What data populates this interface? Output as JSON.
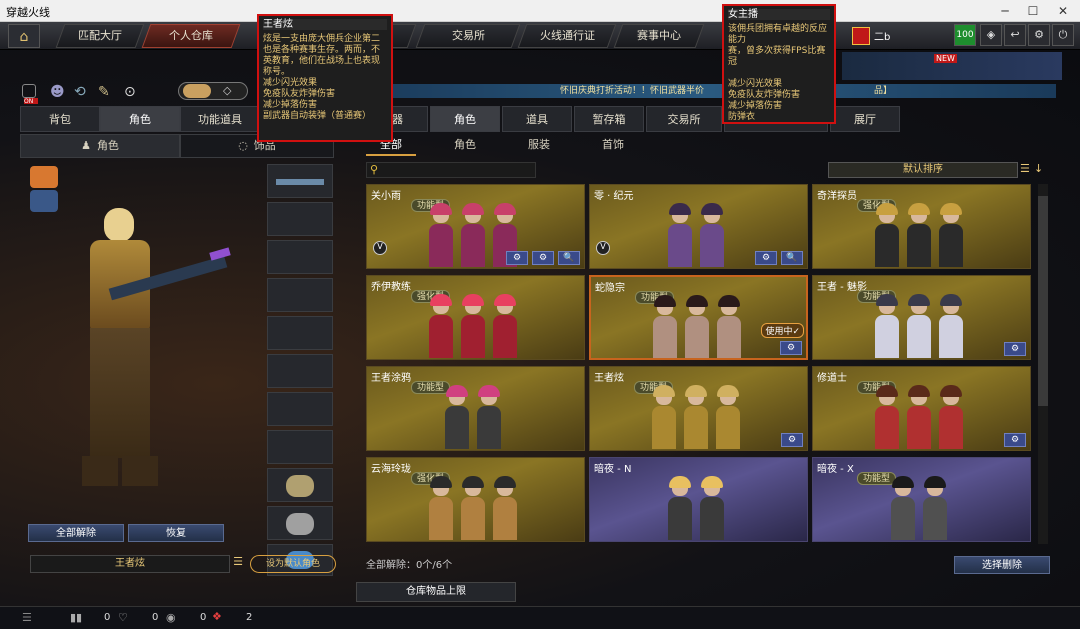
{
  "window": {
    "title": "穿越火线",
    "min": "─",
    "max": "☐",
    "close": "✕"
  },
  "nav": {
    "home_icon": "home-icon",
    "tabs": [
      "匹配大厅",
      "个人仓库",
      "风",
      "交易所",
      "火线通行证",
      "赛事中心",
      "C",
      "赛"
    ],
    "user": "二b",
    "level": "100"
  },
  "left": {
    "tabs": [
      "背包",
      "角色",
      "功能道具",
      "风"
    ],
    "subtabs": [
      "角色",
      "饰品"
    ],
    "buttons": {
      "unequip_all": "全部解除",
      "restore": "恢复",
      "set_default": "设为默认角色"
    },
    "character_name": "王者炫"
  },
  "banner": "怀旧庆典打折活动！！怀旧武器半价",
  "banner_tail": "品】",
  "right": {
    "tabs": [
      "武器",
      "角色",
      "道具",
      "暂存箱",
      "交易所",
      "",
      "展厅"
    ],
    "subtabs": [
      "全部",
      "角色",
      "服装",
      "首饰"
    ],
    "sort": "默认排序",
    "footer": {
      "unequip": "全部解除：0个/6个",
      "select_delete": "选择删除",
      "storage": "仓库物品上限"
    }
  },
  "cards": [
    {
      "name": "关小雨",
      "badge": "功能型",
      "style": "gold",
      "buttons": [
        "⚙",
        "⚙",
        "🔍"
      ]
    },
    {
      "name": "零 · 纪元",
      "badge": "",
      "style": "gold",
      "buttons": [
        "⚙",
        "🔍"
      ]
    },
    {
      "name": "奇洋探员",
      "badge": "强化型",
      "style": "gold",
      "buttons": []
    },
    {
      "name": "乔伊教练",
      "badge": "强化型",
      "style": "gold",
      "buttons": []
    },
    {
      "name": "蛇隐宗",
      "badge": "功能型",
      "style": "selected",
      "status": "使用中✓",
      "buttons": [
        "⚙"
      ]
    },
    {
      "name": "王者 - 魅影",
      "badge": "功能型",
      "style": "gold",
      "buttons": [
        "⚙"
      ]
    },
    {
      "name": "王者涂鸦",
      "badge": "功能型",
      "style": "gold",
      "buttons": []
    },
    {
      "name": "王者炫",
      "badge": "功能型",
      "style": "gold",
      "buttons": [
        "⚙"
      ]
    },
    {
      "name": "修道士",
      "badge": "功能型",
      "style": "gold",
      "buttons": [
        "⚙"
      ]
    },
    {
      "name": "云海玲珑",
      "badge": "强化型",
      "style": "gold",
      "buttons": []
    },
    {
      "name": "暗夜 - N",
      "badge": "",
      "style": "purple",
      "buttons": []
    },
    {
      "name": "暗夜 - X",
      "badge": "功能型",
      "style": "purple",
      "buttons": []
    }
  ],
  "tooltip1": {
    "title": "王者炫",
    "lines": [
      "炫是一支由庞大佣兵企业第二",
      "也是各种赛事生存。两而，不",
      "英教育，他们在战场上也表现",
      "称号。",
      "减少闪光效果",
      "免疫队友炸弹伤害",
      "减少掉落伤害",
      "副武器自动装弹（普通赛）"
    ]
  },
  "tooltip2": {
    "title": "女主播",
    "lines": [
      "该佣兵团拥有卓越的反应能力",
      "赛，曾多次获得FPS比赛冠",
      "",
      "减少闪光效果",
      "免疫队友炸弹伤害",
      "减少掉落伤害",
      "防弹衣"
    ]
  },
  "status": {
    "v1": "0",
    "v2": "0",
    "v3": "0",
    "v4": "0",
    "v5": "2"
  }
}
